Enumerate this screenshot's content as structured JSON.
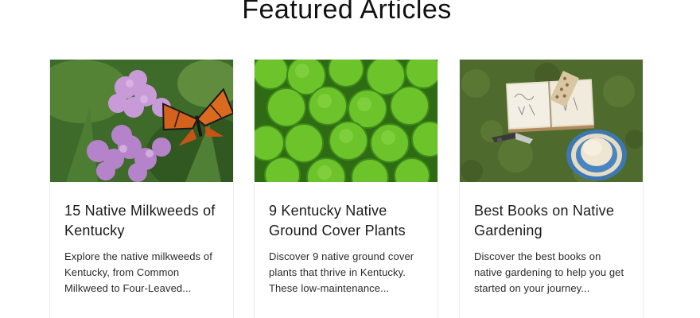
{
  "section": {
    "title": "Featured Articles"
  },
  "articles": [
    {
      "title": "15 Native Milkweeds of Kentucky",
      "excerpt": "Explore the native milkweeds of Kentucky, from Common Milkweed to Four-Leaved...",
      "image_icon": "milkweed-butterfly-image"
    },
    {
      "title": "9 Kentucky Native Ground Cover Plants",
      "excerpt": "Discover 9 native ground cover plants that thrive in Kentucky. These low-maintenance...",
      "image_icon": "ground-cover-leaves-image"
    },
    {
      "title": "Best Books on Native Gardening",
      "excerpt": "Discover the best books on native gardening to help you get started on your journey...",
      "image_icon": "book-hat-garden-image"
    }
  ],
  "colors": {
    "title": "#111111",
    "text": "#2a2a2a",
    "card_border": "#ececec",
    "leaf_green": "#6cc32a",
    "grass_green": "#4f6a2d"
  }
}
